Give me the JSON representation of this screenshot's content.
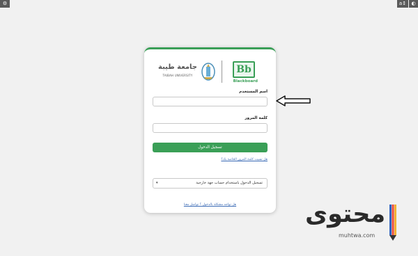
{
  "toolbar": {
    "left_icon": "settings-icon",
    "right_text_icon": "a↕",
    "contrast_icon": "contrast-icon"
  },
  "login": {
    "university_name_ar": "جامعة طيبة",
    "university_name_en": "TAIBAH UNIVERSITY",
    "blackboard_mark": "Bb",
    "blackboard_word": "Blackboard",
    "username_label": "اسم المستخدم",
    "username_value": "",
    "password_label": "كلمة المرور",
    "password_value": "",
    "submit_label": "تسجيل الدخول",
    "forgot_link": "هل نسيت كلمة المرور الخاصة بك؟",
    "external_login": "تسجيل الدخول باستخدام حساب جهة خارجية",
    "help_link": "هل تواجه مشكلة بالدخول ؟ تواصل معنا"
  },
  "colors": {
    "accent": "#3a9f57",
    "link": "#3b6bb5",
    "page_bg": "#f1f1f1"
  },
  "watermark": {
    "text_ar": "محتوى",
    "url": "muhtwa.com"
  }
}
